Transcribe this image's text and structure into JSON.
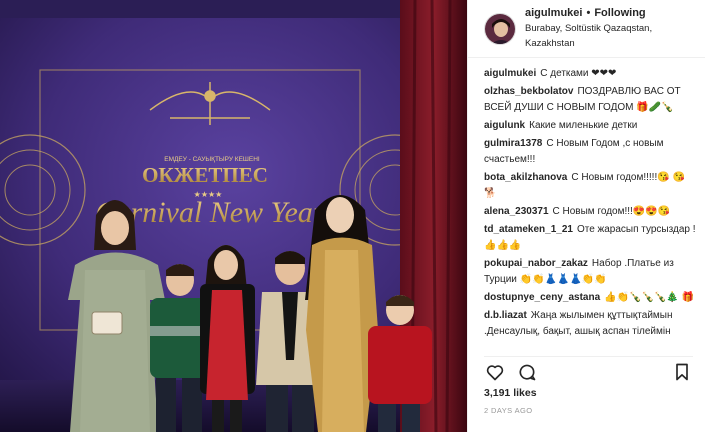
{
  "post": {
    "photo_text": {
      "brand": "ОКЖЕТПЕС",
      "brand_sub": "ЕМДЕУ - САУЫҚТЫРУ КЕШЕНІ",
      "event": "Carnival New Year",
      "stars": "★★★★"
    }
  },
  "header": {
    "username": "aigulmukei",
    "separator": "•",
    "follow_label": "Following",
    "location": "Burabay, Soltüstik Qazaqstan, Kazakhstan"
  },
  "comments": [
    {
      "user": "aigulmukei",
      "text": "С детками ❤❤❤"
    },
    {
      "user": "olzhas_bekbolatov",
      "text": "ПОЗДРАВЛЮ ВАС ОТ ВСЕЙ ДУШИ С НОВЫМ ГОДОМ 🎁🥒🍾"
    },
    {
      "user": "aigulunk",
      "text": "Какие миленькие детки"
    },
    {
      "user": "gulmira1378",
      "text": "С Новым Годом ,с новым счастьем!!!"
    },
    {
      "user": "bota_akilzhanova",
      "text": "С Новым годом!!!!!😘 😘🐕"
    },
    {
      "user": "alena_230371",
      "text": "С Новым годом!!!😍😍😘"
    },
    {
      "user": "td_atameken_1_21",
      "text": "Оте жарасып турсыздар ! 👍👍👍"
    },
    {
      "user": "pokupai_nabor_zakaz",
      "text": "Набор .Платье из Турции 👏👏👗👗👗👏👏"
    },
    {
      "user": "dostupnye_ceny_astana",
      "text": "👍👏🍾🍾🍾🎄 🎁"
    },
    {
      "user": "d.b.liazat",
      "text": "Жаңа жылымен құттықтаймын .Денсаулық, бақыт, ашық аспан тілеймін"
    }
  ],
  "actions": {
    "like_icon": "heart-icon",
    "comment_icon": "comment-icon",
    "bookmark_icon": "bookmark-icon"
  },
  "likes": "3,191 likes",
  "date": "2 DAYS AGO",
  "colors": {
    "backdrop": "#4a3380",
    "gold": "#d8b66a",
    "text": "#262626",
    "muted": "#999999"
  }
}
